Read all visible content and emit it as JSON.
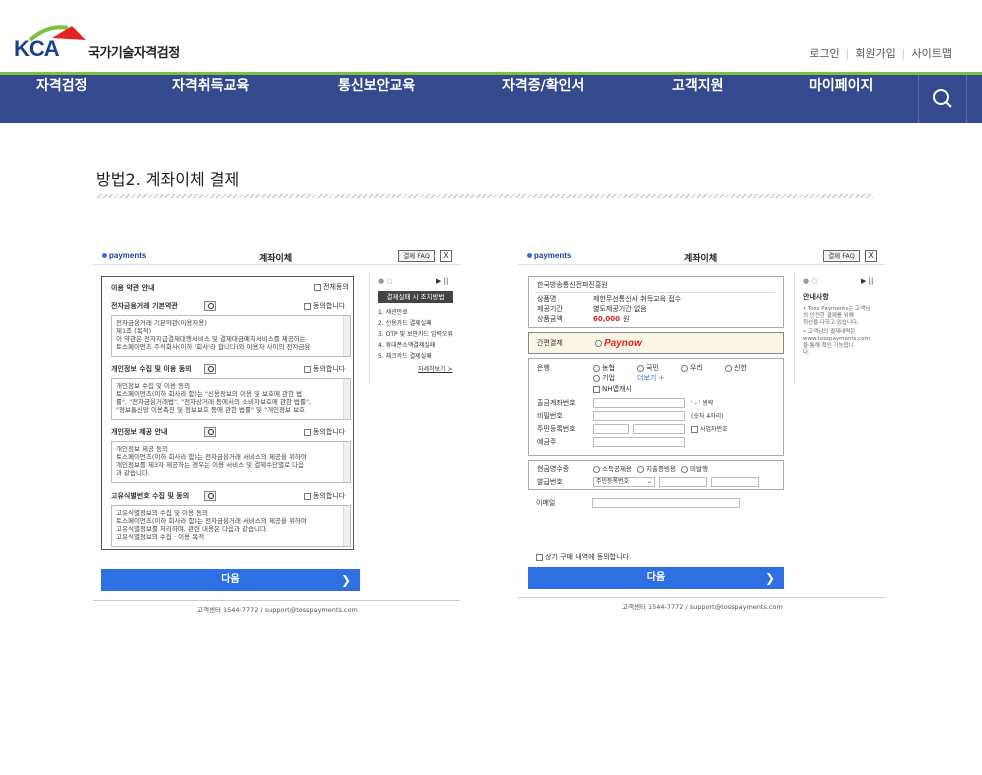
{
  "site": {
    "logo_text": "KCA",
    "name": "국가기술자격검정"
  },
  "utility": [
    "로그인",
    "회원가입",
    "사이트맵"
  ],
  "nav": [
    "자격검정",
    "자격취득교육",
    "통신보안교육",
    "자격증/확인서",
    "고객지원",
    "마이페이지"
  ],
  "section_title": "방법2. 계좌이체 결제",
  "left": {
    "brand": "payments",
    "title": "계좌이체",
    "faq": "결제 FAQ",
    "close": "X",
    "terms_header": "이용 약관 안내",
    "agree_all": "전체동의",
    "agree": "동의합니다",
    "terms": [
      {
        "title": "전자금융거래 기본약관",
        "lines": [
          "전자금융거래 기본약관(이용자용)",
          "제1조 (목적)",
          "이 약관은 전자지급결제대행서비스 및 결제대금예치서비스를 제공하는",
          "토스페이먼츠 주식회사(이하 '회사'라 합니다)와 이용자 사이의 전자금융"
        ]
      },
      {
        "title": "개인정보 수집 및 이용 동의",
        "lines": [
          "개인정보 수집 및 이용 동의",
          "토스페이먼츠(이하 회사라 함)는 \"신용정보의 이용 및 보호에 관한 법",
          "률\", \"전자금융거래법\", \"전자상거래 등에서의 소비자보호에 관한 법률\",",
          "\"정보통신망 이용촉진 및 정보보호 등에 관한 법률\" 및 \"개인정보 보호"
        ]
      },
      {
        "title": "개인정보 제공 안내",
        "lines": [
          "개인정보 제공 동의",
          "토스페이먼츠(이하 회사라 함)는 전자금융거래 서비스의 제공을 위하여",
          "개인정보를 제3자 제공하는 경우는 이용 서비스 및 결제수단별로 다음",
          "과 같습니다."
        ]
      },
      {
        "title": "고유식별번호 수집 및 동의",
        "lines": [
          "고유식별정보의 수집 및 이용 동의",
          "토스페이먼츠(이하 회사라 함)는 전자금융거래 서비스의 제공을 위하여",
          "고유식별정보를 처리하며, 관련 내용은 다음과 같습니다.",
          "고유식별정보의 수집 · 이용 목적"
        ]
      }
    ],
    "side_title": "결제실패 시 조치방법",
    "side_items": [
      "1. 세션만료",
      "2. 신용카드 결제실패",
      "3. OTP 및 보안카드 입력오류",
      "4. 휴대폰소액결제실패",
      "5. 체크카드 결제실패"
    ],
    "side_more": "자세히보기 >",
    "next": "다음",
    "footer": "고객센터 1544-7772 / support@tosspayments.com"
  },
  "right": {
    "brand": "payments",
    "title": "계좌이체",
    "faq": "결제 FAQ",
    "close": "X",
    "merchant": "한국방송통신전파진흥원",
    "info": [
      {
        "label": "상품명",
        "value": "제한무선통신사 취득교육 접수"
      },
      {
        "label": "제공기간",
        "value": "별도제공기간 없음"
      },
      {
        "label": "상품금액",
        "value": "60,000",
        "unit": "원"
      }
    ],
    "easy_pay_label": "간편결제",
    "paynow": "Paynow",
    "bank_label": "은행",
    "banks": [
      "농협",
      "국민",
      "우리",
      "신한",
      "기업"
    ],
    "more": "더보기 +",
    "nh": "NH앱캐시",
    "fields": [
      {
        "label": "출금계좌번호",
        "hint": "' - ' 생략"
      },
      {
        "label": "비밀번호",
        "hint": "(숫자 4자리)"
      },
      {
        "label": "주민등록번호",
        "hint": "사업자번호"
      },
      {
        "label": "예금주",
        "hint": ""
      }
    ],
    "receipt_label": "현금영수증",
    "receipt_opts": [
      "소득공제용",
      "지출증빙용",
      "미발행"
    ],
    "issue_label": "발급번호",
    "issue_select": "주민등록번호",
    "email_label": "이메일",
    "consent": "상기 구매 내역에 동의합니다.",
    "side_title": "안내사항",
    "side_notes": [
      "• Toss Payments는 고객님",
      "의 안전한 결제를 위해",
      "최선을 다하고 있습니다.",
      "• 고객님의 결제내역은",
      "www.tosspayments.com",
      "을 통해 확인 가능합니",
      "다."
    ],
    "next": "다음",
    "footer": "고객센터 1544-7772 / support@tosspayments.com"
  },
  "colors": {
    "nav_bg": "#354a8e",
    "green_line": "#7cc242",
    "button": "#2f6fe4",
    "price": "#e0261a",
    "paynow": "#e0261a"
  }
}
